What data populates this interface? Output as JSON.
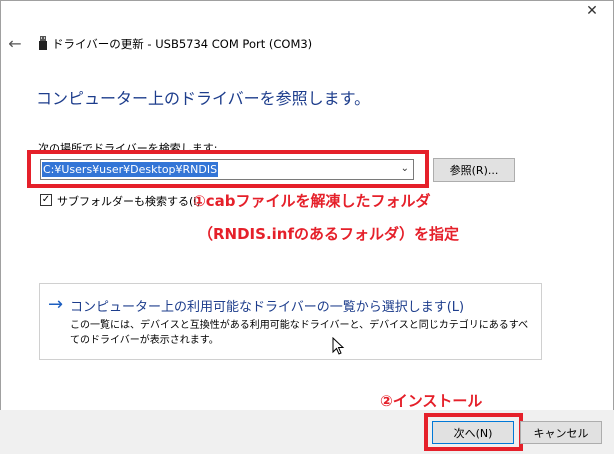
{
  "window": {
    "close_glyph": "✕",
    "back_glyph": "←",
    "title": "ドライバーの更新 - USB5734 COM Port (COM3)"
  },
  "heading": "コンピューター上のドライバーを参照します。",
  "search": {
    "label": "次の場所でドライバーを検索します:",
    "path_value": "C:¥Users¥user¥Desktop¥RNDIS",
    "browse_label": "参照(R)...",
    "include_subfolders_label": "サブフォルダーも検索する(I)",
    "include_subfolders_checked": true
  },
  "annotations": {
    "note1": "①cabファイルを解凍したフォルダ",
    "note2": "（RNDIS.infのあるフォルダ）を指定",
    "note3": "②インストール",
    "color": "#e5202a"
  },
  "pick_option": {
    "title": "コンピューター上の利用可能なドライバーの一覧から選択します(L)",
    "description": "この一覧には、デバイスと互換性がある利用可能なドライバーと、デバイスと同じカテゴリにあるすべてのドライバーが表示されます。"
  },
  "footer": {
    "next_label": "次へ(N)",
    "cancel_label": "キャンセル"
  },
  "colors": {
    "heading_blue": "#1d3d8c",
    "selection_blue": "#3375d6",
    "annotation_red": "#e5202a",
    "footer_gray": "#f0f0f0"
  }
}
